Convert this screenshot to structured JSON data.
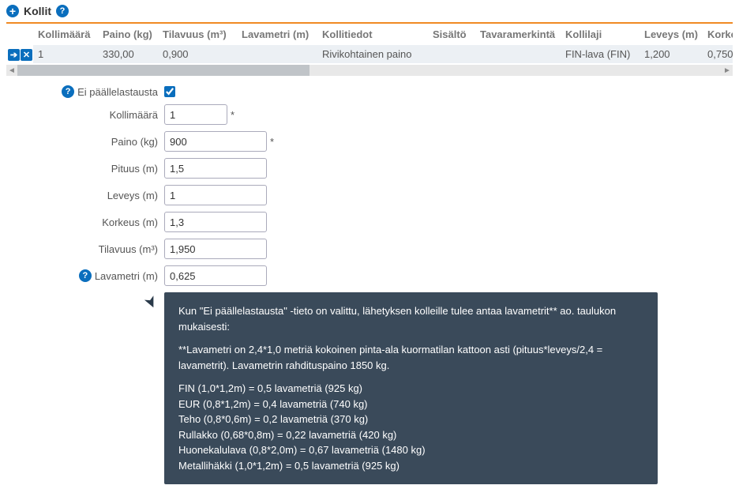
{
  "header": {
    "title": "Kollit"
  },
  "table": {
    "headers": {
      "kollimaara": "Kollimäärä",
      "paino": "Paino (kg)",
      "tilavuus": "Tilavuus (m³)",
      "lavametri": "Lavametri (m)",
      "kollitiedot": "Kollitiedot",
      "sisalto": "Sisältö",
      "tavaramerkinta": "Tavaramerkintä",
      "kollilaji": "Kollilaji",
      "leveys": "Leveys (m)",
      "korkeus": "Korkeus"
    },
    "row": {
      "kollimaara": "1",
      "paino": "330,00",
      "tilavuus": "0,900",
      "lavametri": "",
      "kollitiedot": "Rivikohtainen paino",
      "sisalto": "",
      "tavaramerkinta": "",
      "kollilaji": "FIN-lava (FIN)",
      "leveys": "1,200",
      "korkeus": "0,750"
    }
  },
  "form": {
    "ei_paallelastausta_label": "Ei päällelastausta",
    "kollimaara_label": "Kollimäärä",
    "kollimaara_value": "1",
    "paino_label": "Paino (kg)",
    "paino_value": "900",
    "pituus_label": "Pituus (m)",
    "pituus_value": "1,5",
    "leveys_label": "Leveys (m)",
    "leveys_value": "1",
    "korkeus_label": "Korkeus (m)",
    "korkeus_value": "1,3",
    "tilavuus_label": "Tilavuus (m³)",
    "tilavuus_value": "1,950",
    "lavametri_label": "Lavametri (m)",
    "lavametri_value": "0,625"
  },
  "tooltip": {
    "p1": "Kun \"Ei päällelastausta\" -tieto on valittu, lähetyksen kolleille tulee antaa lavametrit** ao. taulukon mukaisesti:",
    "p2": "**Lavametri on 2,4*1,0 metriä kokoinen pinta-ala kuormatilan kattoon asti (pituus*leveys/2,4 = lavametrit). Lavametrin rahdituspaino 1850 kg.",
    "lines": [
      "FIN (1,0*1,2m) = 0,5 lavametriä (925 kg)",
      "EUR (0,8*1,2m) = 0,4 lavametriä (740 kg)",
      "Teho (0,8*0,6m) = 0,2 lavametriä (370 kg)",
      "Rullakko (0,68*0,8m) = 0,22 lavametriä (420 kg)",
      "Huonekalulava (0,8*2,0m) = 0,67 lavametriä (1480 kg)",
      "Metallihäkki (1,0*1,2m) = 0,5 lavametriä (925 kg)"
    ]
  },
  "icons": {
    "plus": "+",
    "help": "?",
    "arrow": "➔",
    "close": "✕",
    "left": "◄",
    "right": "►",
    "pointer": "☚"
  }
}
